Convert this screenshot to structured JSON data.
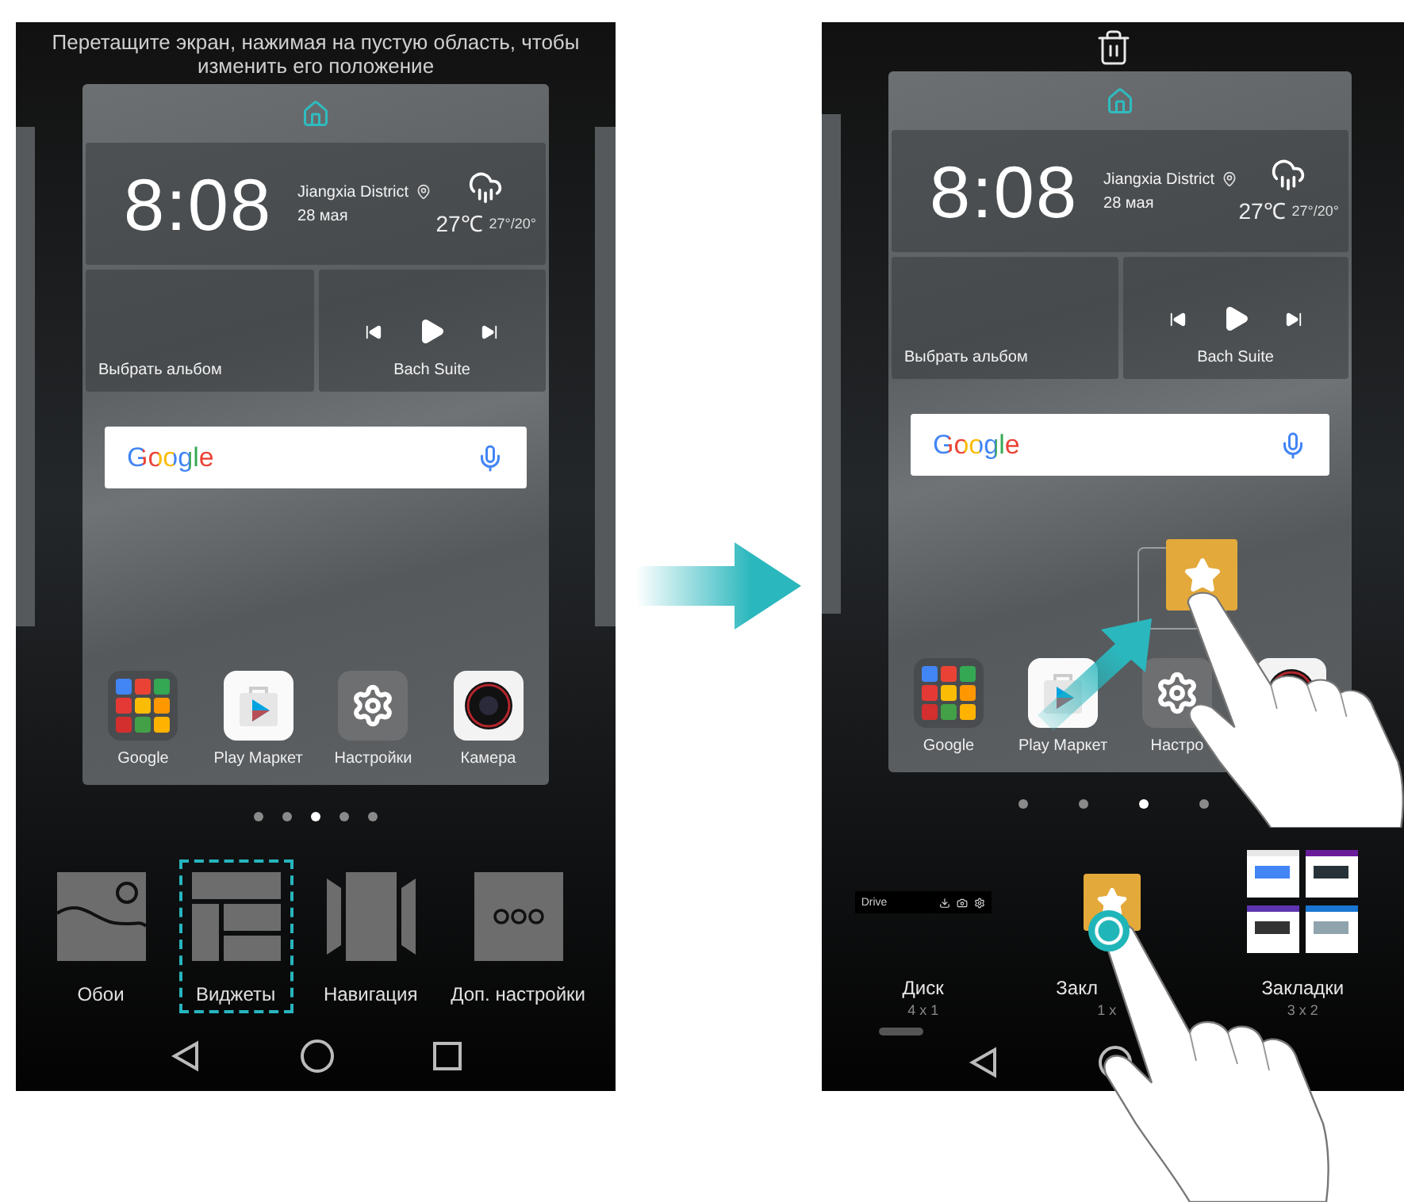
{
  "left_phone": {
    "hint": "Перетащите экран, нажимая на пустую область, чтобы изменить его положение",
    "home_screen": {
      "clock": {
        "time": "8:08",
        "location": "Jiangxia District",
        "date": "28 мая",
        "temperature": "27℃",
        "range": "27°/20°"
      },
      "music": {
        "album": "Выбрать альбом",
        "track": "Bach Suite"
      },
      "search": {
        "logo": "Google"
      },
      "apps": [
        {
          "kind": "folder",
          "label": "Google"
        },
        {
          "kind": "store",
          "label": "Play Маркет"
        },
        {
          "kind": "settings",
          "label": "Настройки"
        },
        {
          "kind": "camera",
          "label": "Камера"
        }
      ]
    },
    "page_dots": [
      {
        "selected": false
      },
      {
        "selected": false
      },
      {
        "selected": true
      },
      {
        "selected": false
      },
      {
        "selected": false
      }
    ],
    "edit_options": [
      {
        "kind": "wallpaper",
        "label": "Обои",
        "selected": false
      },
      {
        "kind": "widgets",
        "label": "Виджеты",
        "selected": true
      },
      {
        "kind": "transition",
        "label": "Навигация",
        "selected": false
      },
      {
        "kind": "more",
        "label": "Доп. настройки",
        "selected": false
      }
    ]
  },
  "right_phone": {
    "home_screen": {
      "clock": {
        "time": "8:08",
        "location": "Jiangxia District",
        "date": "28 мая",
        "temperature": "27℃",
        "range": "27°/20°"
      },
      "music": {
        "album": "Выбрать альбом",
        "track": "Bach Suite"
      },
      "search": {
        "logo": "Google"
      },
      "apps": [
        {
          "kind": "folder",
          "label": "Google"
        },
        {
          "kind": "store",
          "label": "Play Маркет"
        },
        {
          "kind": "settings",
          "label": "Настро"
        },
        {
          "kind": "camera"
        }
      ]
    },
    "page_dots": [
      {
        "selected": false
      },
      {
        "selected": false
      },
      {
        "selected": true
      },
      {
        "selected": false
      }
    ],
    "widgets": [
      {
        "kind": "drive",
        "title": "Диск",
        "size": "4 x 1",
        "preview": "Drive"
      },
      {
        "kind": "star",
        "title": "Закл",
        "size": "1 x"
      },
      {
        "kind": "bookmarks",
        "title": "Закладки",
        "size": "3 x 2"
      }
    ]
  }
}
